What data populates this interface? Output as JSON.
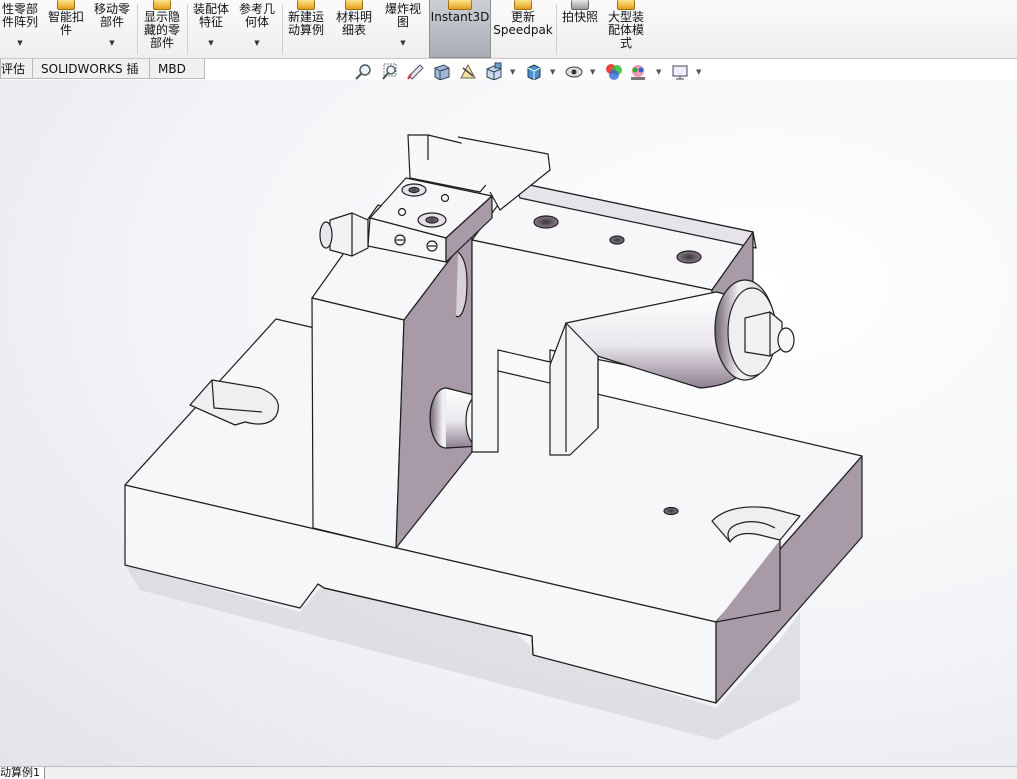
{
  "ribbon": {
    "items": [
      {
        "label": "性零部\n件阵列"
      },
      {
        "label": "智能扣\n件"
      },
      {
        "label": "移动零\n部件"
      },
      {
        "label": "显示隐\n藏的零\n部件"
      },
      {
        "label": "装配体\n特征"
      },
      {
        "label": "参考几\n何体"
      },
      {
        "label": "新建运\n动算例"
      },
      {
        "label": "材料明\n细表"
      },
      {
        "label": "爆炸视\n图"
      },
      {
        "label": "Instant3D"
      },
      {
        "label": "更新\nSpeedpak"
      },
      {
        "label": "拍快照"
      },
      {
        "label": "大型装\n配体模\n式"
      }
    ]
  },
  "tabs": [
    {
      "label": "评估"
    },
    {
      "label": "SOLIDWORKS 插件"
    },
    {
      "label": "MBD"
    }
  ],
  "headsup": {
    "icons": [
      "zoom-to-fit-icon",
      "zoom-to-area-icon",
      "previous-view-icon",
      "section-view-icon",
      "dynamic-annotation-icon",
      "view-orientation-icon",
      "display-style-icon",
      "hide-show-items-icon",
      "edit-appearance-icon",
      "apply-scene-icon",
      "view-settings-icon"
    ]
  },
  "status": {
    "tab_label": "动算例1"
  },
  "colors": {
    "face_light": "#f7f7f9",
    "face_shadow": "#a99aa8",
    "edge": "#1e1e1e",
    "instant3d_active": "#b7bbc1"
  }
}
